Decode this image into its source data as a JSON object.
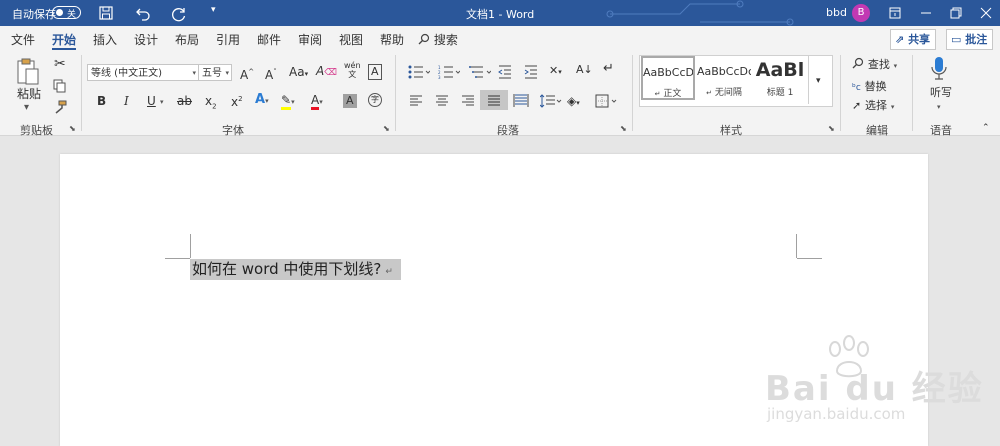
{
  "titlebar": {
    "autosave_label": "自动保存",
    "autosave_state": "关",
    "title": "文档1  -  Word",
    "user_name": "bbd",
    "avatar_initial": "B"
  },
  "tabs": [
    {
      "label": "文件",
      "active": false
    },
    {
      "label": "开始",
      "active": true
    },
    {
      "label": "插入",
      "active": false
    },
    {
      "label": "设计",
      "active": false
    },
    {
      "label": "布局",
      "active": false
    },
    {
      "label": "引用",
      "active": false
    },
    {
      "label": "邮件",
      "active": false
    },
    {
      "label": "审阅",
      "active": false
    },
    {
      "label": "视图",
      "active": false
    },
    {
      "label": "帮助",
      "active": false
    }
  ],
  "search_label": "搜索",
  "share_label": "共享",
  "comment_label": "批注",
  "clipboard": {
    "paste_label": "粘贴",
    "group_label": "剪贴板"
  },
  "font": {
    "name": "等线 (中文正文)",
    "size": "五号",
    "group_label": "字体"
  },
  "paragraph": {
    "group_label": "段落"
  },
  "styles": {
    "items": [
      {
        "preview": "AaBbCcDc",
        "label": "正文",
        "selected": true
      },
      {
        "preview": "AaBbCcDc",
        "label": "无间隔",
        "selected": false
      },
      {
        "preview": "AaBl",
        "label": "标题 1",
        "selected": false
      }
    ],
    "group_label": "样式"
  },
  "editing": {
    "find_label": "查找",
    "replace_label": "替换",
    "select_label": "选择",
    "group_label": "编辑"
  },
  "voice": {
    "dictate_label": "听写",
    "group_label": "语音"
  },
  "document": {
    "text": "如何在 word 中使用下划线?"
  },
  "watermark": {
    "brand": "Bai du 经验",
    "url": "jingyan.baidu.com"
  },
  "colors": {
    "brand_blue": "#2b579a",
    "highlight": "#ffff00",
    "font_color": "#e81123",
    "avatar": "#c239b3"
  }
}
